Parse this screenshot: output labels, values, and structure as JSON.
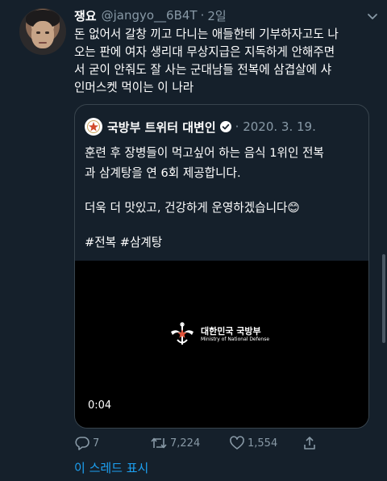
{
  "tweet": {
    "author_name": "쟁요",
    "author_handle": "@jangyo__6B4T",
    "separator": "·",
    "time": "2일",
    "text_lines": [
      "돈 없어서 갈창 끼고 다니는 애들한테 기부하자고도 나",
      "오는 판에 여자 생리대 무상지급은 지독하게 안해주면",
      "서 굳이 안줘도 잘 사는 군대남들 전복에 삼겹살에 샤",
      "인머스켓 먹이는 이 나라"
    ],
    "avatar_icon": "profile-photo",
    "more_icon": "chevron-down-icon"
  },
  "quote": {
    "author_name": "국방부 트위터 대변인",
    "date": "2020. 3. 19.",
    "verified_icon": "verified-badge-icon",
    "text_para1": "훈련 후 장병들이 먹고싶어 하는 음식 1위인 전복과 삼계탕을 연 6회 제공합니다.",
    "text_para1_lines": [
      "훈련 후 장병들이 먹고싶어 하는 음식 1위인 전복",
      "과 삼계탕을 연 6회 제공합니다."
    ],
    "text_para2": "더욱 더 맛있고, 건강하게 운영하겠습니다😊",
    "hashtags": "#전복 #삼계탕",
    "video": {
      "logo_kr": "대한민국 국방부",
      "logo_en": "Ministry of National Defense",
      "duration": "0:04"
    }
  },
  "actions": {
    "reply_count": "7",
    "retweet_count": "7,224",
    "like_count": "1,554"
  },
  "show_thread": "이 스레드 표시",
  "colors": {
    "background": "#15202b",
    "muted": "#8899a6",
    "accent": "#1da1f2",
    "border": "#38444d"
  }
}
